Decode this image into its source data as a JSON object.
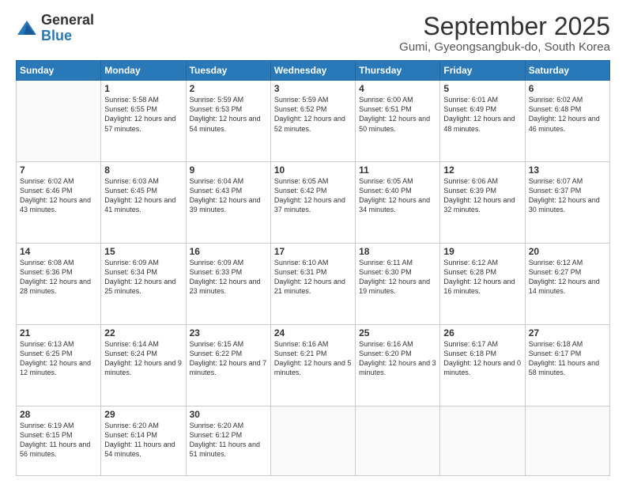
{
  "logo": {
    "general": "General",
    "blue": "Blue"
  },
  "title": "September 2025",
  "subtitle": "Gumi, Gyeongsangbuk-do, South Korea",
  "days": [
    "Sunday",
    "Monday",
    "Tuesday",
    "Wednesday",
    "Thursday",
    "Friday",
    "Saturday"
  ],
  "weeks": [
    [
      {
        "day": "",
        "sunrise": "",
        "sunset": "",
        "daylight": ""
      },
      {
        "day": "1",
        "sunrise": "Sunrise: 5:58 AM",
        "sunset": "Sunset: 6:55 PM",
        "daylight": "Daylight: 12 hours and 57 minutes."
      },
      {
        "day": "2",
        "sunrise": "Sunrise: 5:59 AM",
        "sunset": "Sunset: 6:53 PM",
        "daylight": "Daylight: 12 hours and 54 minutes."
      },
      {
        "day": "3",
        "sunrise": "Sunrise: 5:59 AM",
        "sunset": "Sunset: 6:52 PM",
        "daylight": "Daylight: 12 hours and 52 minutes."
      },
      {
        "day": "4",
        "sunrise": "Sunrise: 6:00 AM",
        "sunset": "Sunset: 6:51 PM",
        "daylight": "Daylight: 12 hours and 50 minutes."
      },
      {
        "day": "5",
        "sunrise": "Sunrise: 6:01 AM",
        "sunset": "Sunset: 6:49 PM",
        "daylight": "Daylight: 12 hours and 48 minutes."
      },
      {
        "day": "6",
        "sunrise": "Sunrise: 6:02 AM",
        "sunset": "Sunset: 6:48 PM",
        "daylight": "Daylight: 12 hours and 46 minutes."
      }
    ],
    [
      {
        "day": "7",
        "sunrise": "Sunrise: 6:02 AM",
        "sunset": "Sunset: 6:46 PM",
        "daylight": "Daylight: 12 hours and 43 minutes."
      },
      {
        "day": "8",
        "sunrise": "Sunrise: 6:03 AM",
        "sunset": "Sunset: 6:45 PM",
        "daylight": "Daylight: 12 hours and 41 minutes."
      },
      {
        "day": "9",
        "sunrise": "Sunrise: 6:04 AM",
        "sunset": "Sunset: 6:43 PM",
        "daylight": "Daylight: 12 hours and 39 minutes."
      },
      {
        "day": "10",
        "sunrise": "Sunrise: 6:05 AM",
        "sunset": "Sunset: 6:42 PM",
        "daylight": "Daylight: 12 hours and 37 minutes."
      },
      {
        "day": "11",
        "sunrise": "Sunrise: 6:05 AM",
        "sunset": "Sunset: 6:40 PM",
        "daylight": "Daylight: 12 hours and 34 minutes."
      },
      {
        "day": "12",
        "sunrise": "Sunrise: 6:06 AM",
        "sunset": "Sunset: 6:39 PM",
        "daylight": "Daylight: 12 hours and 32 minutes."
      },
      {
        "day": "13",
        "sunrise": "Sunrise: 6:07 AM",
        "sunset": "Sunset: 6:37 PM",
        "daylight": "Daylight: 12 hours and 30 minutes."
      }
    ],
    [
      {
        "day": "14",
        "sunrise": "Sunrise: 6:08 AM",
        "sunset": "Sunset: 6:36 PM",
        "daylight": "Daylight: 12 hours and 28 minutes."
      },
      {
        "day": "15",
        "sunrise": "Sunrise: 6:09 AM",
        "sunset": "Sunset: 6:34 PM",
        "daylight": "Daylight: 12 hours and 25 minutes."
      },
      {
        "day": "16",
        "sunrise": "Sunrise: 6:09 AM",
        "sunset": "Sunset: 6:33 PM",
        "daylight": "Daylight: 12 hours and 23 minutes."
      },
      {
        "day": "17",
        "sunrise": "Sunrise: 6:10 AM",
        "sunset": "Sunset: 6:31 PM",
        "daylight": "Daylight: 12 hours and 21 minutes."
      },
      {
        "day": "18",
        "sunrise": "Sunrise: 6:11 AM",
        "sunset": "Sunset: 6:30 PM",
        "daylight": "Daylight: 12 hours and 19 minutes."
      },
      {
        "day": "19",
        "sunrise": "Sunrise: 6:12 AM",
        "sunset": "Sunset: 6:28 PM",
        "daylight": "Daylight: 12 hours and 16 minutes."
      },
      {
        "day": "20",
        "sunrise": "Sunrise: 6:12 AM",
        "sunset": "Sunset: 6:27 PM",
        "daylight": "Daylight: 12 hours and 14 minutes."
      }
    ],
    [
      {
        "day": "21",
        "sunrise": "Sunrise: 6:13 AM",
        "sunset": "Sunset: 6:25 PM",
        "daylight": "Daylight: 12 hours and 12 minutes."
      },
      {
        "day": "22",
        "sunrise": "Sunrise: 6:14 AM",
        "sunset": "Sunset: 6:24 PM",
        "daylight": "Daylight: 12 hours and 9 minutes."
      },
      {
        "day": "23",
        "sunrise": "Sunrise: 6:15 AM",
        "sunset": "Sunset: 6:22 PM",
        "daylight": "Daylight: 12 hours and 7 minutes."
      },
      {
        "day": "24",
        "sunrise": "Sunrise: 6:16 AM",
        "sunset": "Sunset: 6:21 PM",
        "daylight": "Daylight: 12 hours and 5 minutes."
      },
      {
        "day": "25",
        "sunrise": "Sunrise: 6:16 AM",
        "sunset": "Sunset: 6:20 PM",
        "daylight": "Daylight: 12 hours and 3 minutes."
      },
      {
        "day": "26",
        "sunrise": "Sunrise: 6:17 AM",
        "sunset": "Sunset: 6:18 PM",
        "daylight": "Daylight: 12 hours and 0 minutes."
      },
      {
        "day": "27",
        "sunrise": "Sunrise: 6:18 AM",
        "sunset": "Sunset: 6:17 PM",
        "daylight": "Daylight: 11 hours and 58 minutes."
      }
    ],
    [
      {
        "day": "28",
        "sunrise": "Sunrise: 6:19 AM",
        "sunset": "Sunset: 6:15 PM",
        "daylight": "Daylight: 11 hours and 56 minutes."
      },
      {
        "day": "29",
        "sunrise": "Sunrise: 6:20 AM",
        "sunset": "Sunset: 6:14 PM",
        "daylight": "Daylight: 11 hours and 54 minutes."
      },
      {
        "day": "30",
        "sunrise": "Sunrise: 6:20 AM",
        "sunset": "Sunset: 6:12 PM",
        "daylight": "Daylight: 11 hours and 51 minutes."
      },
      {
        "day": "",
        "sunrise": "",
        "sunset": "",
        "daylight": ""
      },
      {
        "day": "",
        "sunrise": "",
        "sunset": "",
        "daylight": ""
      },
      {
        "day": "",
        "sunrise": "",
        "sunset": "",
        "daylight": ""
      },
      {
        "day": "",
        "sunrise": "",
        "sunset": "",
        "daylight": ""
      }
    ]
  ]
}
